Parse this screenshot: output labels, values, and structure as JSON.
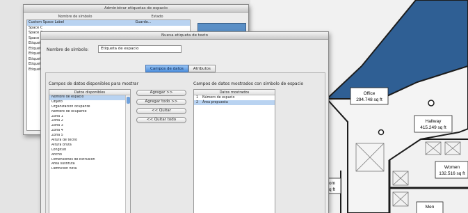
{
  "back_window": {
    "title": "Administrar etiquetas de espacio",
    "col_name": "Nombre de símbolo",
    "col_state": "Estado",
    "rows": [
      {
        "name": "Custom Space Label",
        "state": "Guardo..."
      },
      {
        "name": "Space C",
        "state": ""
      },
      {
        "name": "Space C",
        "state": ""
      },
      {
        "name": "Space C",
        "state": ""
      },
      {
        "name": "Etiquet",
        "state": ""
      },
      {
        "name": "Etiquet",
        "state": ""
      },
      {
        "name": "Etiquet",
        "state": ""
      },
      {
        "name": "Etiquet",
        "state": ""
      },
      {
        "name": "Etiquet",
        "state": ""
      },
      {
        "name": "Etiquet",
        "state": ""
      }
    ]
  },
  "front_window": {
    "title": "Nueva etiqueta de texto",
    "symbol_name_label": "Nombre de símbolo:",
    "symbol_name_value": "Etiqueta de espacio",
    "tabs": [
      {
        "label": "Campos de datos",
        "active": true
      },
      {
        "label": "Atributos",
        "active": false
      }
    ],
    "available_title": "Campos de datos disponibles para mostrar",
    "available_header": "Datos disponibles",
    "available_items": [
      "Nombre de espacio",
      "Objeto",
      "Organización ocupante",
      "Nombre de ocupante",
      "Zona 1",
      "Zona 2",
      "Zona 3",
      "Zona 4",
      "Zona 5",
      "Altura de techo",
      "Altura bruta",
      "Longitud",
      "Ancho",
      "Dimensiones de Extrusión",
      "Área sustituta",
      "Definición nota"
    ],
    "available_selected_index": 0,
    "buttons": {
      "add": "Agregar >>",
      "add_all": "Agregar todo >>",
      "remove": "<< Quitar",
      "remove_all": "<< Quitar todo"
    },
    "shown_title": "Campos de datos mostrados con símbolo de espacio",
    "shown_header": "Datos mostrados",
    "shown_items": [
      {
        "num": "1",
        "label": "Número de espacio"
      },
      {
        "num": "2",
        "label": "Área propuesta"
      }
    ],
    "shown_selected_index": 1
  },
  "floor_plan": {
    "rooms": [
      {
        "name": "Office",
        "area": "294.748 sq ft"
      },
      {
        "name": "Hallway",
        "area": "415.249 sq ft"
      },
      {
        "name": "Women",
        "area": "132.516 sq ft"
      },
      {
        "name": "Men",
        "area": ""
      },
      {
        "name": "om",
        "area": "q ft"
      }
    ],
    "colors": {
      "selected_room": "#2f5f94",
      "background": "#f2f2f2"
    }
  }
}
